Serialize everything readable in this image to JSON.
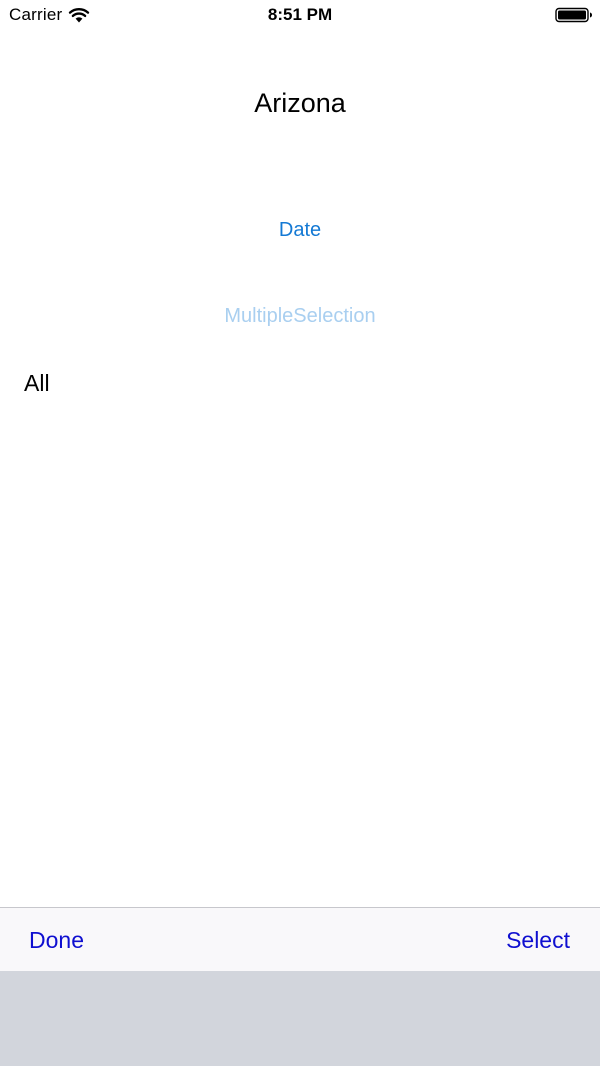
{
  "status_bar": {
    "carrier": "Carrier",
    "time": "8:51 PM",
    "icons": [
      "wifi-icon",
      "battery-icon"
    ]
  },
  "main": {
    "title": "Arizona",
    "date_button_label": "Date",
    "multiple_selection_label": "MultipleSelection",
    "selection_value": "All"
  },
  "toolbar": {
    "done_label": "Done",
    "select_label": "Select"
  },
  "colors": {
    "link_blue": "#1479d4",
    "disabled_blue": "#a9cff0",
    "toolbar_button_blue": "#0f0fd0",
    "toolbar_background": "#f9f8fa",
    "picker_background": "#d2d5dc"
  }
}
